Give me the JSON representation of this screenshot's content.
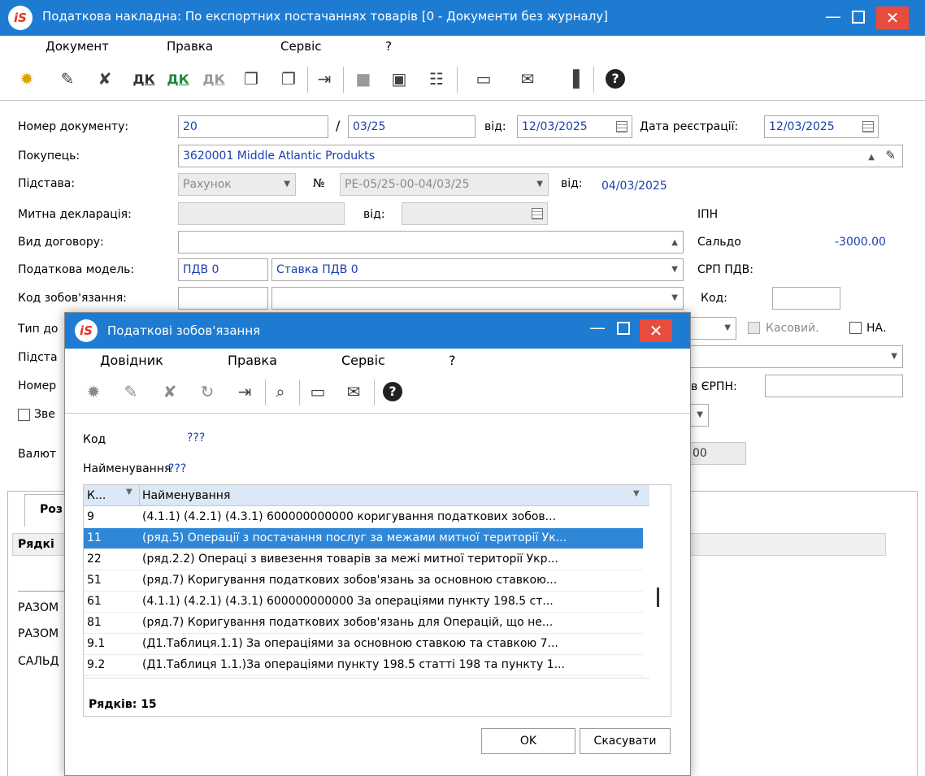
{
  "main": {
    "title": "Податкова накладна: По експортних  постачаннях товарів [0 - Документи без журналу]",
    "logo_text": "iS",
    "menu": [
      "Документ",
      "Правка",
      "Сервіс",
      "?"
    ],
    "form": {
      "doc_number_label": "Номер документу:",
      "doc_number": "20",
      "slash": "/",
      "doc_suffix": "03/25",
      "from_label": "від:",
      "doc_date": "12/03/2025",
      "reg_date_label": "Дата реєстрації:",
      "reg_date": "12/03/2025",
      "buyer_label": "Покупець:",
      "buyer": "3620001  Middle Atlantic Produkts",
      "basis_label": "Підстава:",
      "basis_type": "Рахунок",
      "basis_no_label": "№",
      "basis_no": "РЕ-05/25-00-04/03/25",
      "basis_from_label": "від:",
      "basis_date": "04/03/2025",
      "customs_label": "Митна декларація:",
      "customs_from_label": "від:",
      "ipn_label": "ІПН",
      "contract_label": "Вид договору:",
      "saldo_label": "Сальдо",
      "saldo": "-3000.00",
      "tax_model_label": "Податкова модель:",
      "tax_model_code": "ПДВ  0",
      "tax_model_name": "Ставка ПДВ 0",
      "srp_label": "СРП ПДВ:",
      "obligation_label": "Код зобов'язання:",
      "code_label": "Код:",
      "type_label": "Тип до",
      "cash_label": "Касовий.",
      "na_label": "НА.",
      "basis2_label": "Підста",
      "number_label": "Номер",
      "erpn_label": "в ЄРПН:",
      "zve_label": "Зве",
      "currency_label": "Валют",
      "currency_value": "00",
      "tab_label": "Роз",
      "rows_label": "Рядкі",
      "total1": "РАЗОМ",
      "total2": "РАЗОМ",
      "saldo_row": "САЛЬД"
    }
  },
  "dialog": {
    "title": "Податкові зобов'язання",
    "menu": [
      "Довідник",
      "Правка",
      "Сервіс",
      "?"
    ],
    "code_label": "Код",
    "code_value": "???",
    "name_label": "Найменування",
    "name_value": "???",
    "grid": {
      "col1": "К...",
      "col2": "Найменування",
      "rows": [
        {
          "code": "9",
          "name": "(4.1.1) (4.2.1) (4.3.1) 600000000000 коригування податкових зобов..."
        },
        {
          "code": "11",
          "name": "(ряд.5) Операції з постачання послуг за межами митної території Ук..."
        },
        {
          "code": "22",
          "name": "(ряд.2.2) Операці з вивезення товарів за межі митної території Укр..."
        },
        {
          "code": "51",
          "name": "(ряд.7) Коригування податкових зобов'язань за основною ставкою..."
        },
        {
          "code": "61",
          "name": "(4.1.1) (4.2.1) (4.3.1) 600000000000 За операціями пункту 198.5 ст..."
        },
        {
          "code": "81",
          "name": "(ряд.7) Коригування податкових зобов'язань для  Операцій, що не..."
        },
        {
          "code": "9.1",
          "name": "(Д1.Таблиця.1.1) За операціями за основною ставкою та ставкою 7..."
        },
        {
          "code": "9.2",
          "name": "(Д1.Таблиця 1.1.)За операціями пункту 198.5 статті 198 та пункту 1..."
        }
      ],
      "selected_code": "11",
      "footer": "Рядків: 15"
    },
    "ok": "OK",
    "cancel": "Скасувати"
  },
  "colors": {
    "titlebar": "#1e7bd2",
    "close": "#e84c3d",
    "selection": "#2f87d8",
    "value": "#1a3fb0"
  }
}
